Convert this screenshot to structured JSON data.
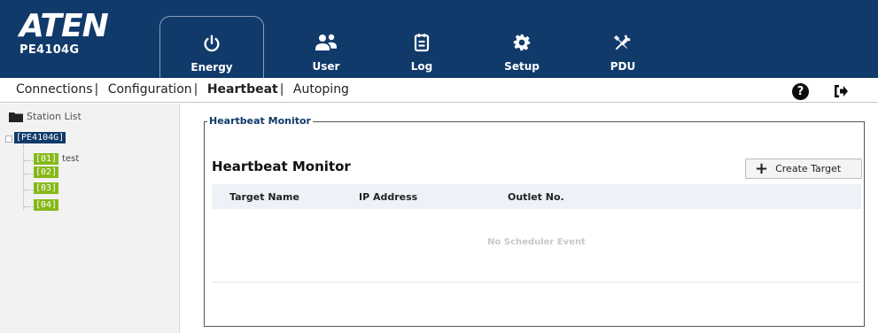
{
  "header": {
    "logo": "ATEN",
    "model": "PE4104G",
    "tabs": [
      {
        "label": "Energy",
        "icon": "power-icon",
        "active": true
      },
      {
        "label": "User",
        "icon": "users-icon",
        "active": false
      },
      {
        "label": "Log",
        "icon": "log-icon",
        "active": false
      },
      {
        "label": "Setup",
        "icon": "gear-icon",
        "active": false
      },
      {
        "label": "PDU",
        "icon": "tools-icon",
        "active": false
      }
    ]
  },
  "subnav": {
    "items": [
      "Connections",
      "Configuration",
      "Heartbeat",
      "Autoping"
    ],
    "separator": "|",
    "current": "Heartbeat",
    "help": "?"
  },
  "sidebar": {
    "title": "Station List",
    "root": "[PE4104G]",
    "ports": [
      {
        "tag": "[01]",
        "name": "test"
      },
      {
        "tag": "[02]",
        "name": ""
      },
      {
        "tag": "[03]",
        "name": ""
      },
      {
        "tag": "[04]",
        "name": ""
      }
    ]
  },
  "main": {
    "legend": "Heartbeat Monitor",
    "title": "Heartbeat Monitor",
    "create_button": "Create Target",
    "columns": [
      "Target Name",
      "IP Address",
      "Outlet No."
    ],
    "empty_message": "No Scheduler Event"
  },
  "colors": {
    "header_bg": "#103a6a",
    "port_tag": "#86b817",
    "legend_text": "#103a6a"
  }
}
